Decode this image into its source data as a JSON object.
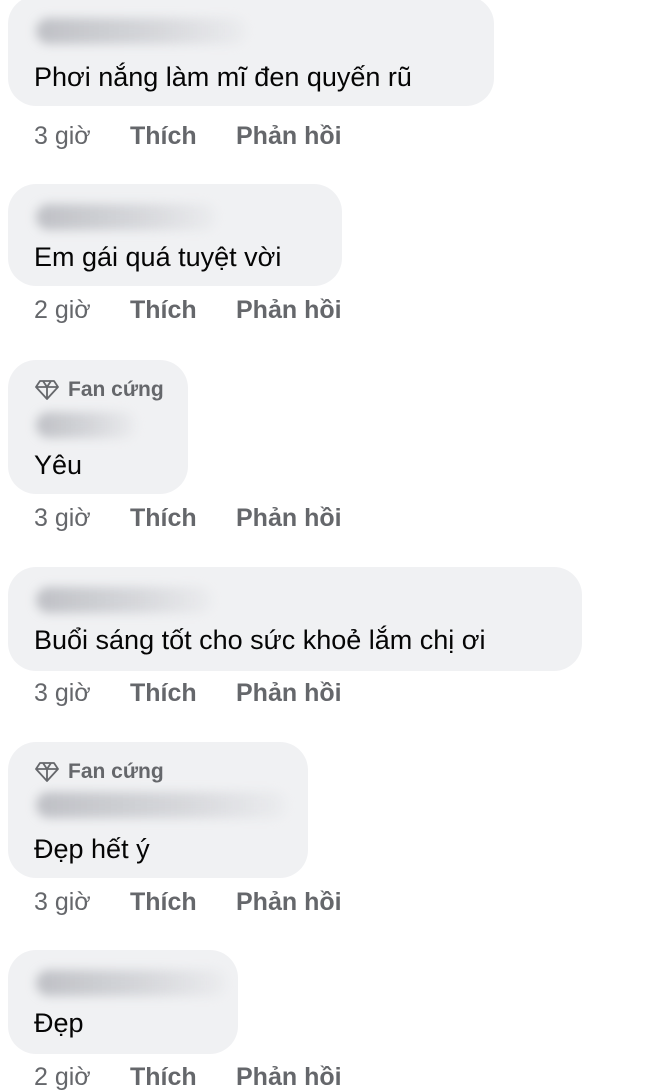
{
  "actions": {
    "like_label": "Thích",
    "reply_label": "Phản hồi"
  },
  "comments": [
    {
      "badge": "",
      "text": "Phơi nắng làm mĩ đen quyến rũ",
      "time": "3 giờ"
    },
    {
      "badge": "",
      "text": "Em gái quá tuyệt vời",
      "time": "2 giờ"
    },
    {
      "badge": "Fan cứng",
      "text": "Yêu",
      "time": "3 giờ"
    },
    {
      "badge": "",
      "text": "Buổi sáng tốt cho sức khoẻ lắm chị ơi",
      "time": "3 giờ"
    },
    {
      "badge": "Fan cứng",
      "text": "Đẹp hết ý",
      "time": "3 giờ"
    },
    {
      "badge": "",
      "text": "Đẹp",
      "time": "2 giờ"
    }
  ],
  "colors": {
    "bubble": "#f0f1f3",
    "text": "#050505",
    "secondary": "#65676b"
  },
  "icons": {
    "badge": "diamond-icon"
  }
}
